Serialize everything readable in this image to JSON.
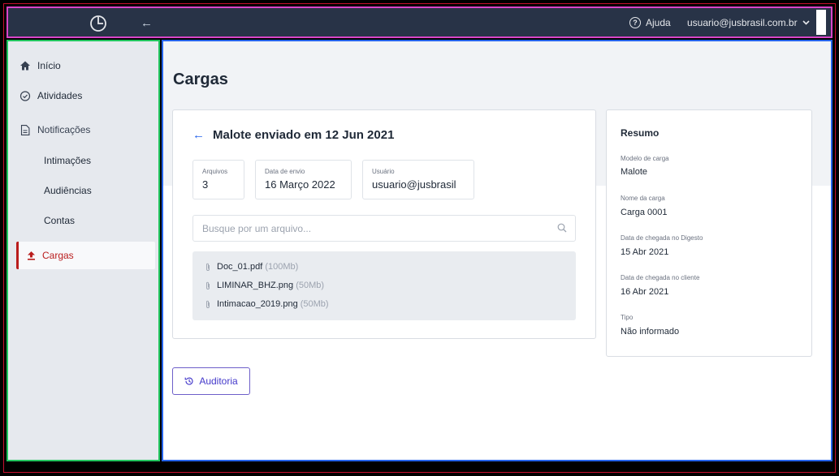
{
  "topbar": {
    "back_arrow": "←",
    "help_label": "Ajuda",
    "help_icon": "help-circle-icon",
    "user_email": "usuario@jusbrasil.com.br",
    "user_chevron": "⌄"
  },
  "sidebar": {
    "items": [
      {
        "label": "Início",
        "icon": "home-icon"
      },
      {
        "label": "Atividades",
        "icon": "check-circle-icon"
      },
      {
        "label": "Notificações",
        "icon": "document-icon"
      },
      {
        "label": "Intimações"
      },
      {
        "label": "Audiências"
      },
      {
        "label": "Contas"
      },
      {
        "label": "Cargas",
        "icon": "upload-icon",
        "active": true
      }
    ]
  },
  "main": {
    "title": "Cargas",
    "card": {
      "back_arrow": "←",
      "title": "Malote enviado em 12 Jun 2021",
      "info": [
        {
          "key": "Arquivos",
          "value": "3"
        },
        {
          "key": "Data de envio",
          "value": "16 Março 2022"
        },
        {
          "key": "Usuário",
          "value": "usuario@jusbrasil"
        }
      ],
      "search_placeholder": "Busque por um arquivo...",
      "files": [
        {
          "name": "Doc_01.pdf",
          "size": "(100Mb)"
        },
        {
          "name": "LIMINAR_BHZ.png",
          "size": "(50Mb)"
        },
        {
          "name": "Intimacao_2019.png",
          "size": "(50Mb)"
        }
      ]
    },
    "summary": {
      "title": "Resumo",
      "fields": [
        {
          "key": "Modelo de carga",
          "value": "Malote"
        },
        {
          "key": "Nome da carga",
          "value": "Carga 0001"
        },
        {
          "key": "Data de chegada no Digesto",
          "value": "15 Abr 2021"
        },
        {
          "key": "Data de chegada no cliente",
          "value": "16 Abr 2021"
        },
        {
          "key": "Tipo",
          "value": "Não informado"
        }
      ]
    },
    "audit_button": "Auditoria"
  },
  "colors": {
    "topbar": "#283347",
    "accent_active": "#b91c1c",
    "link_blue": "#2563eb",
    "button_purple": "#4338ca"
  }
}
